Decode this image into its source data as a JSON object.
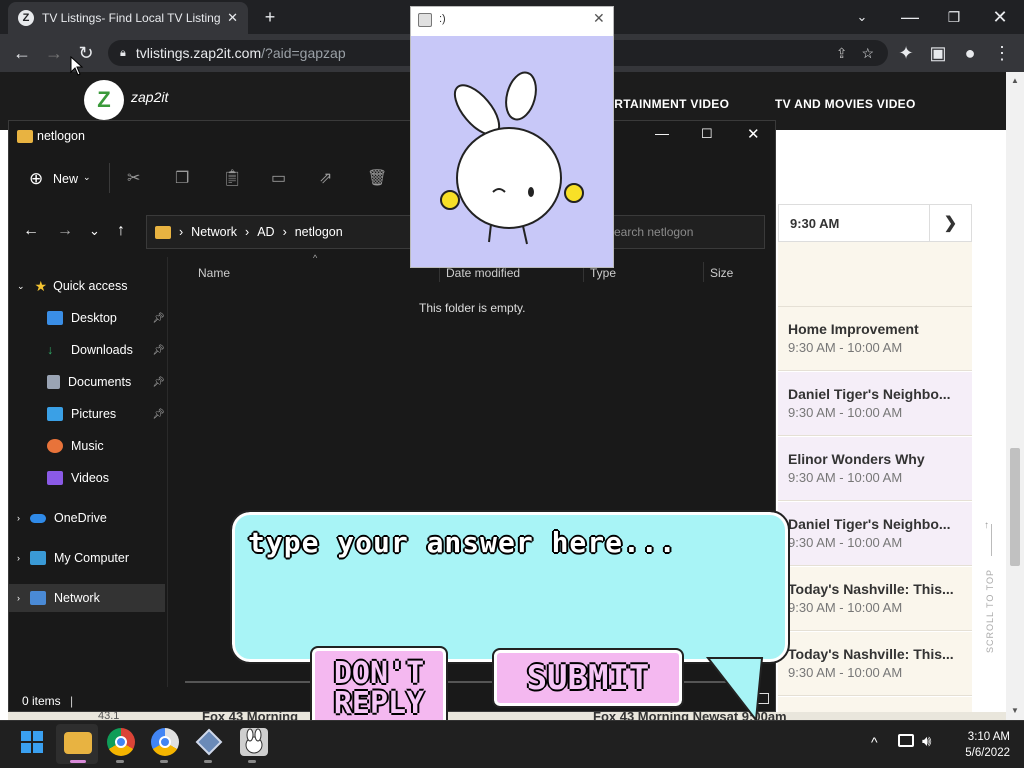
{
  "browser": {
    "tab_title": "TV Listings- Find Local TV Listing",
    "favicon_letter": "Z",
    "tab_close": "✕",
    "new_tab": "+",
    "url_host": "tvlistings.zap2it.com",
    "url_path": "/?aid=gapzap"
  },
  "site": {
    "logo": "zap2it",
    "nav": [
      "ERTAINMENT VIDEO",
      "TV AND MOVIES VIDEO"
    ],
    "time_header": "9:30 AM",
    "shows": [
      {
        "title": "Home Improvement",
        "time": "9:30 AM - 10:00 AM"
      },
      {
        "title": "Daniel Tiger's Neighbo...",
        "time": "9:30 AM - 10:00 AM"
      },
      {
        "title": "Elinor Wonders Why",
        "time": "9:30 AM - 10:00 AM"
      },
      {
        "title": "Daniel Tiger's Neighbo...",
        "time": "9:30 AM - 10:00 AM"
      },
      {
        "title": "Today's Nashville: This...",
        "time": "9:30 AM - 10:00 AM"
      },
      {
        "title": "Today's Nashville: This...",
        "time": "9:30 AM - 10:00 AM"
      }
    ],
    "scroll_to_top": "SCROLL TO TOP",
    "bottom_row_left": "Fox 43 Morning",
    "bottom_row_right": "Fox 43 Morning Newsat 9:00am",
    "bottom_channel": "43.1"
  },
  "explorer": {
    "title": "netlogon",
    "new_label": "New",
    "breadcrumb": [
      "Network",
      "AD",
      "netlogon"
    ],
    "search_placeholder": "Search netlogon",
    "columns": [
      "Name",
      "Date modified",
      "Type",
      "Size"
    ],
    "empty_message": "This folder is empty.",
    "status": "0 items",
    "sidebar": {
      "quick_access": "Quick access",
      "items": [
        "Desktop",
        "Downloads",
        "Documents",
        "Pictures",
        "Music",
        "Videos"
      ],
      "onedrive": "OneDrive",
      "my_computer": "My Computer",
      "network": "Network"
    }
  },
  "popup": {
    "title": ":)"
  },
  "bubble": {
    "prompt": "type your answer here...",
    "dont_reply": "DON'T REPLY",
    "submit": "SUBMIT"
  },
  "taskbar": {
    "time": "3:10 AM",
    "date": "5/6/2022"
  },
  "colors": {
    "bubble_fill": "#a8f4f6",
    "button_fill": "#f4b8f0",
    "popup_bg": "#c8c8f8",
    "site_header": "#1c1c1c"
  }
}
